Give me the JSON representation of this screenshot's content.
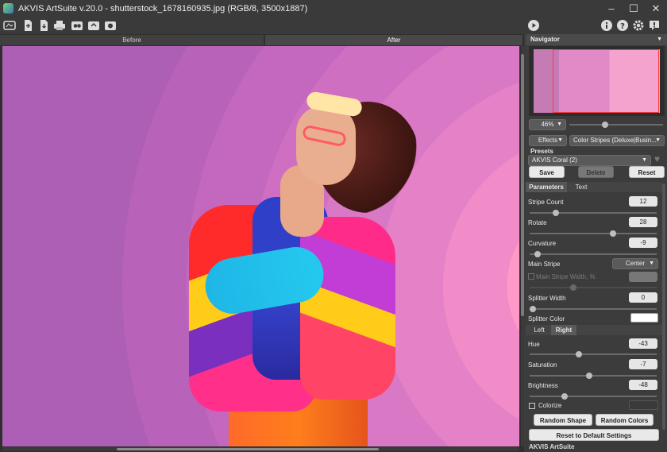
{
  "window": {
    "title": "AKVIS ArtSuite v.20.0 - shutterstock_1678160935.jpg (RGB/8, 3500x1887)",
    "minimize": "–",
    "maximize": "☐",
    "close": "✕"
  },
  "toolbar": {
    "icons": [
      "home-icon",
      "open-icon",
      "save-icon",
      "print-icon",
      "batch-icon",
      "plugin-icon",
      "settings-alt-icon"
    ],
    "right_icons": [
      "run-icon",
      "info-icon",
      "help-icon",
      "settings-icon",
      "feedback-icon"
    ]
  },
  "canvas": {
    "tab_before": "Before",
    "tab_after": "After"
  },
  "navigator": {
    "title": "Navigator",
    "zoom": "46%"
  },
  "effects": {
    "effects_label": "Effects",
    "effect_name": "Color Stripes (Deluxe|Busin..."
  },
  "presets": {
    "title": "Presets",
    "selected": "AKVIS Coral (2)",
    "save": "Save",
    "delete": "Delete",
    "reset": "Reset"
  },
  "tabs": {
    "parameters": "Parameters",
    "text": "Text"
  },
  "params": {
    "stripe_count": {
      "label": "Stripe Count",
      "value": "12"
    },
    "rotate": {
      "label": "Rotate",
      "value": "28"
    },
    "curvature": {
      "label": "Curvature",
      "value": "-9"
    },
    "main_stripe": {
      "label": "Main Stripe",
      "value": "Center"
    },
    "main_stripe_width": {
      "label": "Main Stripe Width, %",
      "value": ""
    },
    "splitter_width": {
      "label": "Splitter Width",
      "value": "0"
    },
    "splitter_color": {
      "label": "Splitter Color",
      "value": "#ffffff"
    }
  },
  "side_tabs": {
    "left": "Left",
    "right": "Right"
  },
  "color_params": {
    "hue": {
      "label": "Hue",
      "value": "-43"
    },
    "saturation": {
      "label": "Saturation",
      "value": "-7"
    },
    "brightness": {
      "label": "Brightness",
      "value": "-48"
    },
    "colorize": {
      "label": "Colorize"
    }
  },
  "buttons": {
    "random_shape": "Random Shape",
    "random_colors": "Random Colors",
    "reset_default": "Reset to Default Settings"
  },
  "footer": {
    "title": "AKVIS ArtSuite"
  },
  "colors": {
    "accent_frame": "#ff3b3b",
    "panel_bg": "#3c3c3c"
  }
}
